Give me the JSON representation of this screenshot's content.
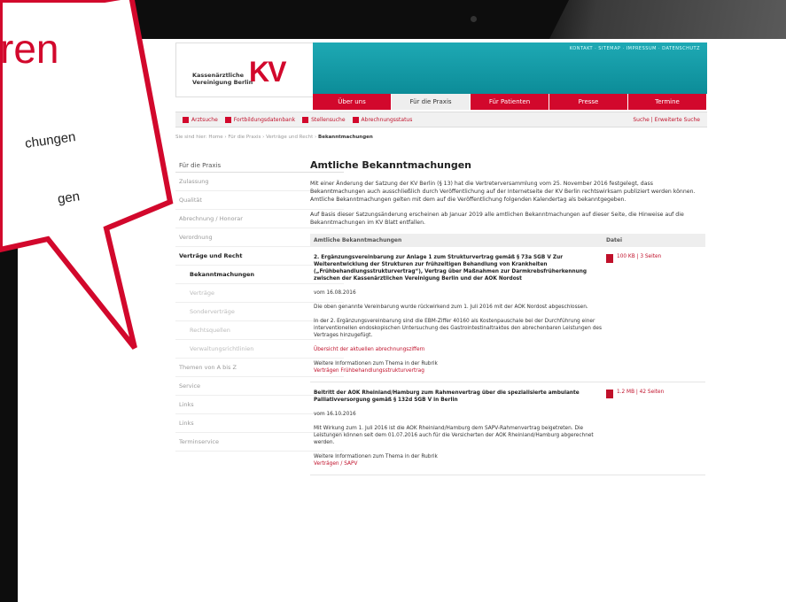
{
  "bubble": {
    "line1": "ren",
    "line2": "chungen",
    "line3": "gen"
  },
  "site": {
    "logo_text": "Kassenärztliche\nVereinigung Berlin",
    "logo_kv": "KV",
    "top_links": "KONTAKT · SITEMAP · IMPRESSUM · DATENSCHUTZ",
    "nav": [
      "Über uns",
      "Für die Praxis",
      "Für Patienten",
      "Presse",
      "Termine"
    ],
    "subnav": [
      "Arztsuche",
      "Fortbildungsdatenbank",
      "Stellensuche",
      "Abrechnungsstatus"
    ],
    "subnav_right": "Suche | Erweiterte Suche",
    "breadcrumb_path": "Sie sind hier: Home › Für die Praxis › Verträge und Recht ›",
    "breadcrumb_current": "Bekanntmachungen"
  },
  "sidebar": {
    "head": "Für die Praxis",
    "items": [
      "Zulassung",
      "Qualität",
      "Abrechnung / Honorar",
      "Verordnung",
      "Verträge und Recht",
      "Bekanntmachungen",
      "Verträge",
      "Sonderverträge",
      "Rechtsquellen",
      "Verwaltungsrichtlinien",
      "Themen von A bis Z",
      "Service",
      "Links",
      "Links",
      "Terminservice"
    ]
  },
  "content": {
    "title": "Amtliche Bekanntmachungen",
    "para1": "Mit einer Änderung der Satzung der KV Berlin (§ 13) hat die Vertreterversammlung vom 25. November 2016 festgelegt, dass Bekanntmachungen auch ausschließlich durch Veröffentlichung auf der Internetseite der KV Berlin rechtswirksam publiziert werden können. Amtliche Bekanntmachungen gelten mit dem auf die Veröffentlichung folgenden Kalendertag als bekanntgegeben.",
    "para2": "Auf Basis dieser Satzungsänderung erscheinen ab Januar 2019 alle amtlichen Bekanntmachungen auf dieser Seite, die Hinweise auf die Bekanntmachungen im KV Blatt entfallen.",
    "col1": "Amtliche Bekanntmachungen",
    "col2": "Datei",
    "rows": [
      {
        "title": "2. Ergänzungsvereinbarung zur Anlage 1 zum Strukturvertrag gemäß § 73a SGB V Zur Weiterentwicklung der Strukturen zur frühzeitigen Behandlung von Krankheiten („Frühbehandlungsstrukturvertrag“), Vertrag über Maßnahmen zur Darmkrebsfrüherkennung zwischen der Kassenärztlichen Vereinigung Berlin und der AOK Nordost",
        "date": "vom 16.08.2016",
        "desc1": "Die oben genannte Vereinbarung wurde rückwirkend zum 1. Juli 2016 mit der AOK Nordost abgeschlossen.",
        "desc2": "In der 2. Ergänzungsvereinbarung sind die EBM-Ziffer 40160 als Kostenpauschale bei der Durchführung einer interventionellen endoskopischen Untersuchung des Gastrointestinaltraktes den abrechenbaren Leistungen des Vertrages hinzugefügt.",
        "link": "Übersicht der aktuellen abrechnungsziffern",
        "more": "Weitere Informationen zum Thema in der Rubrik",
        "more_link": "Verträgen Frühbehandlungsstrukturvertrag",
        "file": "100 KB | 3 Seiten"
      },
      {
        "title": "Beitritt der AOK Rheinland/Hamburg zum Rahmenvertrag über die spezialisierte ambulante Palliativversorgung gemäß § 132d SGB V in Berlin",
        "date": "vom 16.10.2016",
        "desc1": "Mit Wirkung zum 1. Juli 2016 ist die AOK Rheinland/Hamburg dem SAPV-Rahmenvertrag beigetreten. Die Leistungen können seit dem 01.07.2016 auch für die Versicherten der AOK Rheinland/Hamburg abgerechnet werden.",
        "desc2": "",
        "link": "",
        "more": "Weitere Informationen zum Thema in der Rubrik",
        "more_link": "Verträgen / SAPV",
        "file": "1.2 MB | 42 Seiten"
      }
    ]
  }
}
